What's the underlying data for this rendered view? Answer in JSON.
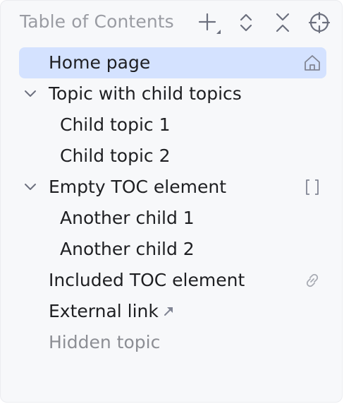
{
  "panel": {
    "title": "Table of Contents",
    "toolbar": {
      "add_icon": "plus-with-dropdown-icon",
      "expand_icon": "expand-all-icon",
      "collapse_icon": "collapse-all-icon",
      "locate_icon": "crosshair-locate-icon"
    }
  },
  "tree": {
    "items": [
      {
        "label": "Home page",
        "trailing_icon": "home-icon",
        "selected": true
      },
      {
        "label": "Topic with child topics",
        "expanded": true
      },
      {
        "label": "Child topic 1"
      },
      {
        "label": "Child topic 2"
      },
      {
        "label": "Empty TOC element",
        "expanded": true,
        "trailing_icon": "brackets-icon"
      },
      {
        "label": "Another child 1"
      },
      {
        "label": "Another child 2"
      },
      {
        "label": "Included TOC element",
        "trailing_icon": "link-icon"
      },
      {
        "label": "External link",
        "inline_icon": "external-arrow-icon"
      },
      {
        "label": "Hidden topic",
        "muted": true
      }
    ]
  },
  "colors": {
    "panel_bg": "#f7f8fa",
    "selection": "#d4e2ff",
    "text": "#1e1f22",
    "muted_text": "#8c8e94",
    "icon": "#6c707e"
  }
}
